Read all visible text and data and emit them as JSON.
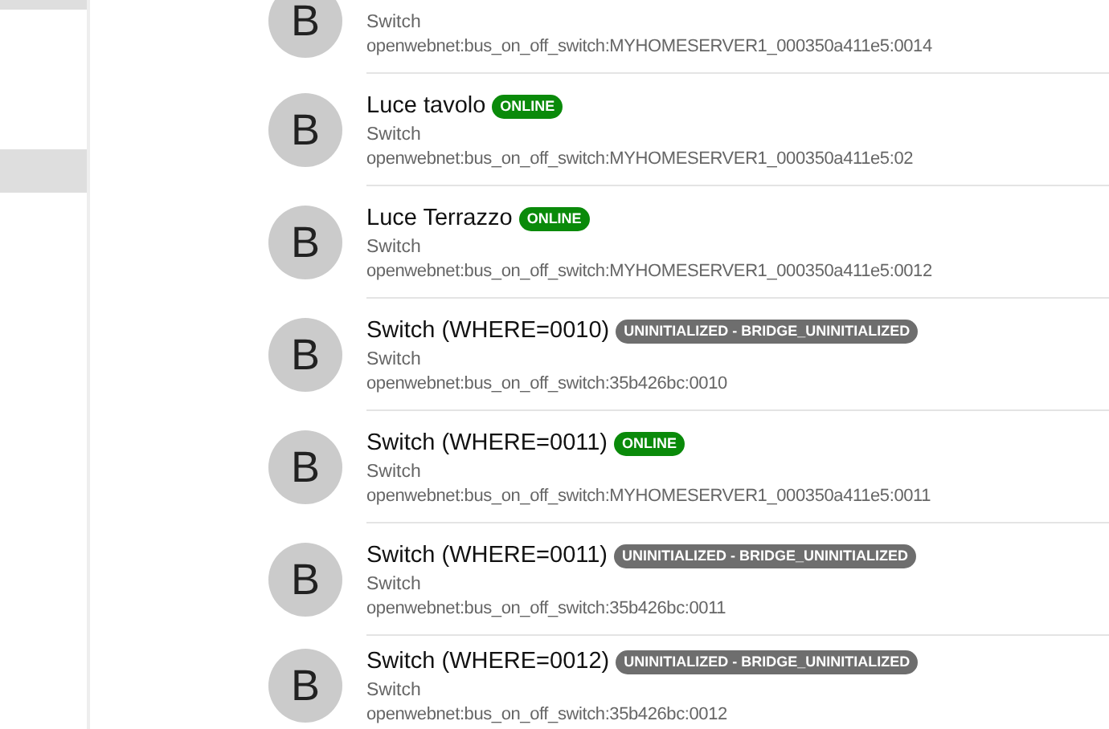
{
  "sidebar": {
    "items": [
      {
        "selected": true
      },
      {
        "selected": false
      },
      {
        "selected": true
      }
    ]
  },
  "things": [
    {
      "type": "Switch",
      "uid": "openwebnet:bus_on_off_switch:MYHOMESERVER1_000350a411e5:0014",
      "avatar": "B"
    },
    {
      "title": "Luce tavolo",
      "status": {
        "kind": "online",
        "label": "ONLINE"
      },
      "type": "Switch",
      "uid": "openwebnet:bus_on_off_switch:MYHOMESERVER1_000350a411e5:02",
      "avatar": "B"
    },
    {
      "title": "Luce Terrazzo",
      "status": {
        "kind": "online",
        "label": "ONLINE"
      },
      "type": "Switch",
      "uid": "openwebnet:bus_on_off_switch:MYHOMESERVER1_000350a411e5:0012",
      "avatar": "B"
    },
    {
      "title": "Switch (WHERE=0010)",
      "status": {
        "kind": "uninitialized",
        "label": "UNINITIALIZED - BRIDGE_UNINITIALIZED"
      },
      "type": "Switch",
      "uid": "openwebnet:bus_on_off_switch:35b426bc:0010",
      "avatar": "B"
    },
    {
      "title": "Switch (WHERE=0011)",
      "status": {
        "kind": "online",
        "label": "ONLINE"
      },
      "type": "Switch",
      "uid": "openwebnet:bus_on_off_switch:MYHOMESERVER1_000350a411e5:0011",
      "avatar": "B"
    },
    {
      "title": "Switch (WHERE=0011)",
      "status": {
        "kind": "uninitialized",
        "label": "UNINITIALIZED - BRIDGE_UNINITIALIZED"
      },
      "type": "Switch",
      "uid": "openwebnet:bus_on_off_switch:35b426bc:0011",
      "avatar": "B"
    },
    {
      "title": "Switch (WHERE=0012)",
      "status": {
        "kind": "uninitialized",
        "label": "UNINITIALIZED - BRIDGE_UNINITIALIZED"
      },
      "type": "Switch",
      "uid": "openwebnet:bus_on_off_switch:35b426bc:0012",
      "avatar": "B"
    }
  ]
}
